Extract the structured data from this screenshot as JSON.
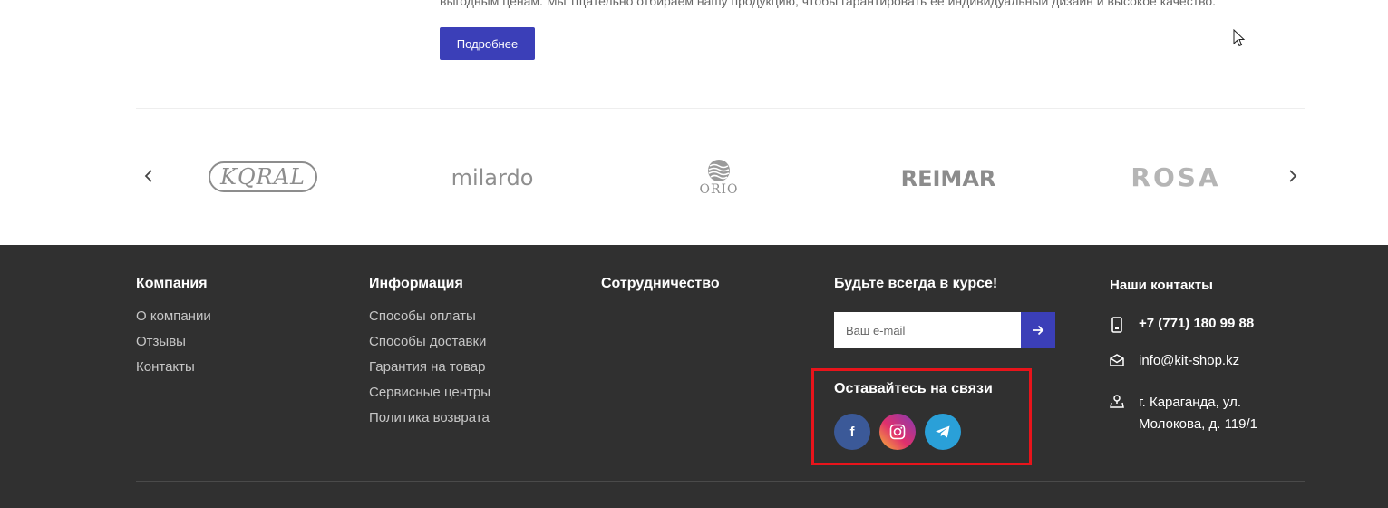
{
  "intro": {
    "text": "выгодным ценам. Мы тщательно отбираем нашу продукцию, чтобы гарантировать ее индивидуальный дизайн и высокое качество.",
    "more_label": "Подробнее"
  },
  "brands": {
    "items": [
      {
        "name": "KQRAL"
      },
      {
        "name": "milardo"
      },
      {
        "name": "ORIO"
      },
      {
        "name": "REIMAR"
      },
      {
        "name": "ROSA"
      }
    ]
  },
  "footer": {
    "company": {
      "title": "Компания",
      "links": [
        "О компании",
        "Отзывы",
        "Контакты"
      ]
    },
    "info": {
      "title": "Информация",
      "links": [
        "Способы оплаты",
        "Способы доставки",
        "Гарантия на товар",
        "Сервисные центры",
        "Политика возврата"
      ]
    },
    "partners": {
      "title": "Сотрудничество"
    },
    "subscribe": {
      "title": "Будьте всегда в курсе!",
      "placeholder": "Ваш e-mail"
    },
    "social": {
      "title": "Оставайтесь на связи",
      "icons": [
        "facebook-icon",
        "instagram-icon",
        "telegram-icon"
      ],
      "facebook_letter": "f"
    },
    "contacts": {
      "title": "Наши контакты",
      "phone": "+7 (771) 180 99 88",
      "email": "info@kit-shop.kz",
      "address_line1": "г. Караганда, ул.",
      "address_line2": "Молокова, д. 119/1"
    }
  },
  "colors": {
    "accent": "#3b3fb8",
    "footer_bg": "#303030",
    "highlight": "#e8141b"
  }
}
